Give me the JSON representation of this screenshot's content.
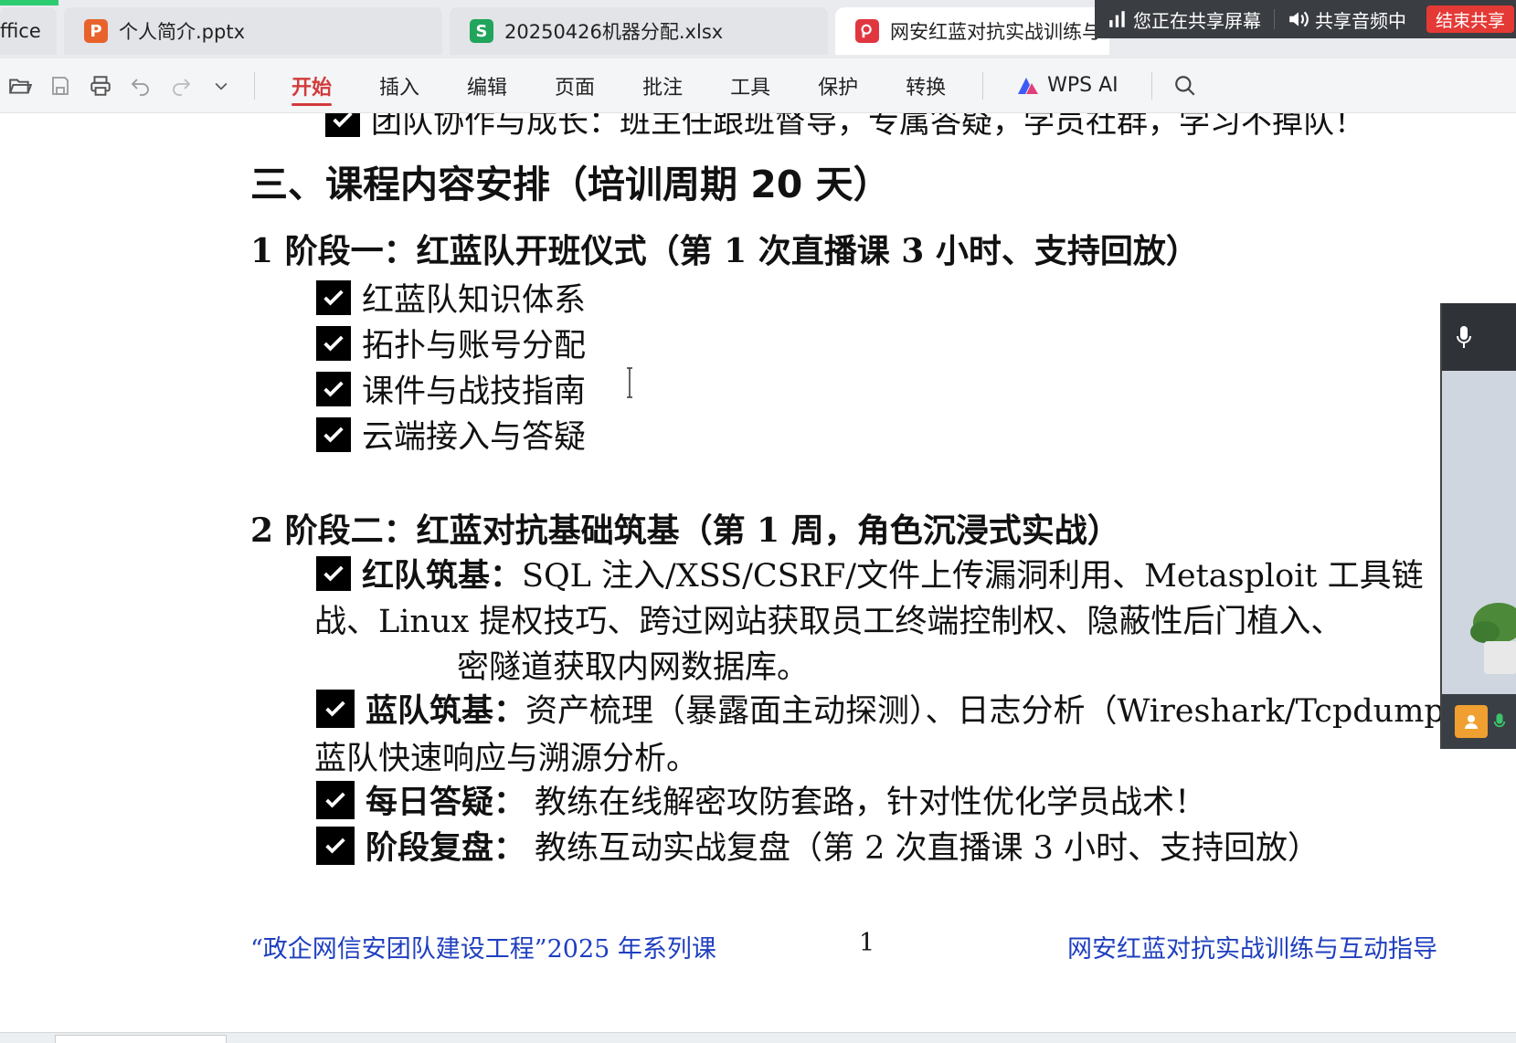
{
  "tabs": [
    {
      "name": "office",
      "label": "ffice"
    },
    {
      "name": "pptx",
      "label": "个人简介.pptx",
      "badge": "P",
      "badge_color": "#e8632b"
    },
    {
      "name": "xlsx",
      "label": "20250426机器分配.xlsx",
      "badge": "S",
      "badge_color": "#21a45b"
    },
    {
      "name": "pdf",
      "label": "网安红蓝对抗实战训练与",
      "badge_color": "#e03640"
    }
  ],
  "share_bar": {
    "sharing_screen": "您正在共享屏幕",
    "sharing_audio": "共享音频中",
    "end_button": "结束共享"
  },
  "toolbar": {
    "menus": [
      "开始",
      "插入",
      "编辑",
      "页面",
      "批注",
      "工具",
      "保护",
      "转换"
    ],
    "active_menu": "开始",
    "wps_ai": "WPS AI",
    "accent_color": "#d23b3b"
  },
  "document": {
    "cut_line": "团队协作与成长：班主任跟班督导，专属答疑，学员社群，学习不掉队！",
    "section_title": "三、课程内容安排（培训周期 20 天）",
    "stage1": {
      "title": "1  阶段一：红蓝队开班仪式（第 1 次直播课 3 小时、支持回放）",
      "items": [
        "红蓝队知识体系",
        "拓扑与账号分配",
        "课件与战技指南",
        "云端接入与答疑"
      ]
    },
    "stage2": {
      "title": "2  阶段二：红蓝对抗基础筑基（第 1 周，角色沉浸式实战）",
      "red_label": "红队筑基：",
      "red_text_1": "SQL 注入/XSS/CSRF/文件上传漏洞利用、Metasploit 工具链",
      "red_text_2": "战、Linux 提权技巧、跨过网站获取员工终端控制权、隐蔽性后门植入、",
      "red_text_3": "密隧道获取内网数据库。",
      "blue_label": "蓝队筑基：",
      "blue_text_1": "资产梳理（暴露面主动探测）、日志分析（Wireshark/Tcpdump",
      "blue_text_2": "蓝队快速响应与溯源分析。",
      "qa_label": "每日答疑：",
      "qa_text": "教练在线解密攻防套路，针对性优化学员战术！",
      "review_label": "阶段复盘：",
      "review_text": "教练互动实战复盘（第 2 次直播课 3 小时、支持回放）"
    },
    "footer": {
      "left": "“政企网信安团队建设工程”2025 年系列课",
      "page": "1",
      "right": "网安红蓝对抗实战训练与互动指导",
      "color": "#1f3fbf"
    }
  }
}
